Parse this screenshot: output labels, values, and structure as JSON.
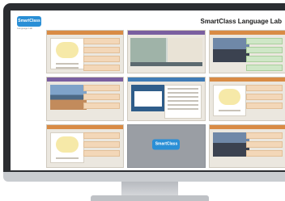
{
  "app": {
    "title": "SmartClass Language Lab",
    "logo_text": "SmartClass",
    "logo_sub": "Language Lab"
  },
  "colors": {
    "monitor_frame": "#2b2d31",
    "brand_blue": "#2a8fd6",
    "panel_bar_orange": "#d98b45",
    "panel_bar_purple": "#7a5fa0",
    "panel_bar_blue": "#3f7bb6"
  },
  "panels": [
    {
      "id": "p1",
      "type": "quiz-lesson"
    },
    {
      "id": "p2",
      "type": "video-lesson"
    },
    {
      "id": "p3",
      "type": "photo-quiz"
    },
    {
      "id": "p4",
      "type": "landscape-quiz"
    },
    {
      "id": "p5",
      "type": "document-lesson"
    },
    {
      "id": "p6",
      "type": "quiz-lesson"
    },
    {
      "id": "p7",
      "type": "quiz-lesson"
    },
    {
      "id": "p8",
      "type": "brand-splash"
    },
    {
      "id": "p9",
      "type": "photo-quiz"
    }
  ]
}
